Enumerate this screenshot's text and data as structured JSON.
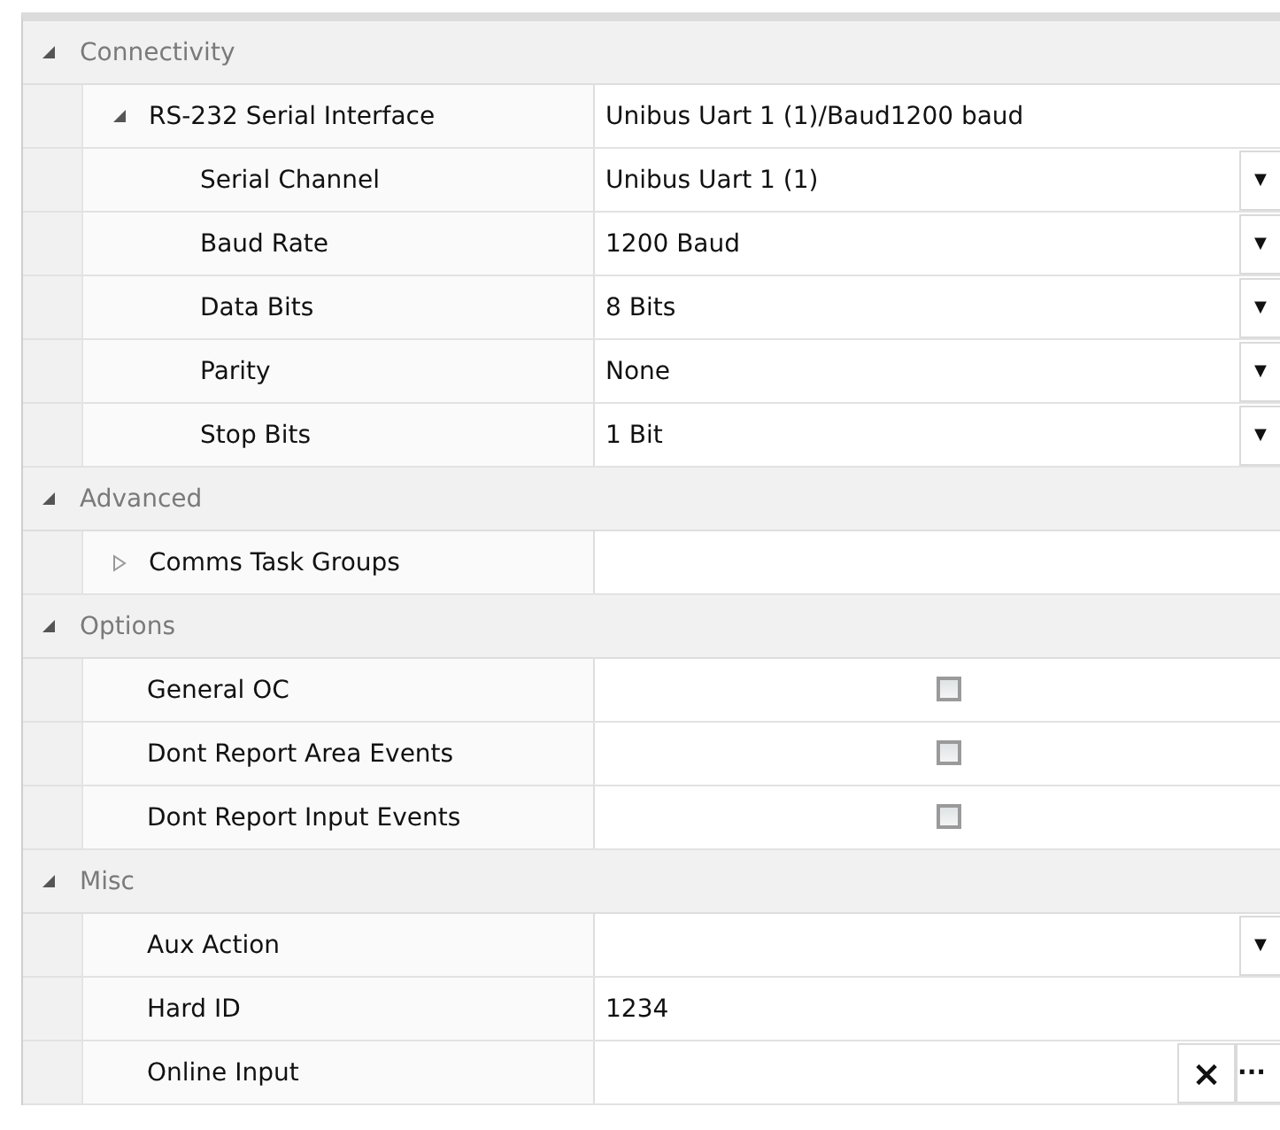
{
  "categories": [
    {
      "title": "Connectivity",
      "expanded": true,
      "properties": [
        {
          "name": "RS-232 Serial Interface",
          "kind": "text",
          "value": "Unibus Uart 1 (1)/Baud1200 baud",
          "expanded": true,
          "children": [
            {
              "name": "Serial Channel",
              "kind": "dropdown",
              "value": "Unibus Uart 1 (1)",
              "caret": "▼"
            },
            {
              "name": "Baud Rate",
              "kind": "dropdown",
              "value": "1200 Baud",
              "caret": "▼"
            },
            {
              "name": "Data Bits",
              "kind": "dropdown",
              "value": "8 Bits",
              "caret": "▼"
            },
            {
              "name": "Parity",
              "kind": "dropdown",
              "value": "None",
              "caret": "▼"
            },
            {
              "name": "Stop Bits",
              "kind": "dropdown",
              "value": "1 Bit",
              "caret": "▼"
            }
          ]
        }
      ]
    },
    {
      "title": "Advanced",
      "expanded": true,
      "properties": [
        {
          "name": "Comms Task Groups",
          "kind": "text",
          "expanded": false
        }
      ]
    },
    {
      "title": "Options",
      "expanded": true,
      "properties": [
        {
          "name": "General OC",
          "kind": "checkbox",
          "checked": false
        },
        {
          "name": "Dont Report Area Events",
          "kind": "checkbox",
          "checked": false
        },
        {
          "name": "Dont Report Input Events",
          "kind": "checkbox",
          "checked": false
        }
      ]
    },
    {
      "title": "Misc",
      "expanded": true,
      "properties": [
        {
          "name": "Aux Action",
          "kind": "dropdown",
          "caret": "▼"
        },
        {
          "name": "Hard ID",
          "kind": "text",
          "value": "1234"
        },
        {
          "name": "Online Input",
          "kind": "browse",
          "buttons": [
            "×",
            "···"
          ]
        }
      ]
    }
  ]
}
